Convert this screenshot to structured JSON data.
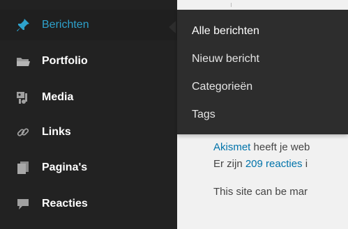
{
  "sidebar": {
    "items": [
      {
        "label": "Berichten",
        "icon": "pin-icon",
        "active": true
      },
      {
        "label": "Portfolio",
        "icon": "folder-icon"
      },
      {
        "label": "Media",
        "icon": "media-icon"
      },
      {
        "label": "Links",
        "icon": "link-icon"
      },
      {
        "label": "Pagina's",
        "icon": "pages-icon"
      },
      {
        "label": "Reacties",
        "icon": "comments-icon"
      }
    ]
  },
  "flyout": {
    "items": [
      "Alle berichten",
      "Nieuw bericht",
      "Categorieën",
      "Tags"
    ]
  },
  "main": {
    "line1_link": "Akismet",
    "line1_text": " heeft je web",
    "line2_prefix": "Er zijn ",
    "line2_link": "209 reacties",
    "line2_suffix": " i",
    "line3": "This site can be mar"
  },
  "colors": {
    "sidebar_bg": "#222222",
    "flyout_bg": "#2d2d2d",
    "accent": "#2ea2cc",
    "link": "#0073aa",
    "page_bg": "#f1f1f1"
  }
}
